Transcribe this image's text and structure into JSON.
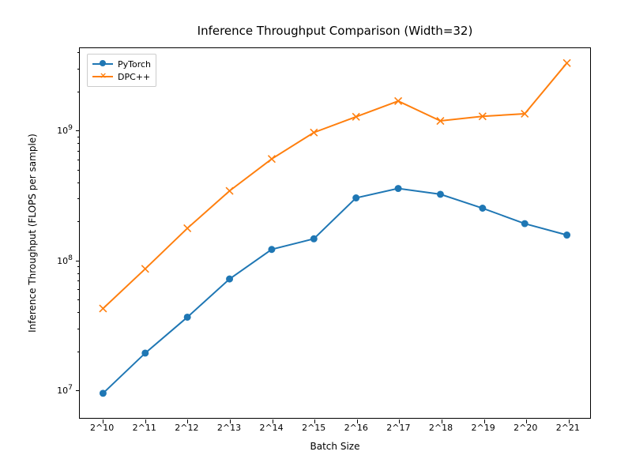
{
  "chart_data": {
    "type": "line",
    "title": "Inference Throughput Comparison (Width=32)",
    "xlabel": "Batch Size",
    "ylabel": "Inference Throughput (FLOPS per sample)",
    "yscale": "log",
    "ylim": [
      6000000.0,
      4300000000.0
    ],
    "categories": [
      "2^10",
      "2^11",
      "2^12",
      "2^13",
      "2^14",
      "2^15",
      "2^16",
      "2^17",
      "2^18",
      "2^19",
      "2^20",
      "2^21"
    ],
    "yticks": [
      {
        "value": 10000000.0,
        "label": "10^7"
      },
      {
        "value": 100000000.0,
        "label": "10^8"
      },
      {
        "value": 1000000000.0,
        "label": "10^9"
      }
    ],
    "series": [
      {
        "name": "PyTorch",
        "color": "#1f77b4",
        "marker": "o",
        "values": [
          9300000.0,
          19000000.0,
          36000000.0,
          71000000.0,
          120000000.0,
          145000000.0,
          300000000.0,
          355000000.0,
          320000000.0,
          250000000.0,
          190000000.0,
          155000000.0
        ]
      },
      {
        "name": "DPC++",
        "color": "#ff7f0e",
        "marker": "x",
        "values": [
          42000000.0,
          85000000.0,
          175000000.0,
          340000000.0,
          600000000.0,
          960000000.0,
          1270000000.0,
          1680000000.0,
          1180000000.0,
          1280000000.0,
          1340000000.0,
          3300000000.0
        ]
      }
    ],
    "legend_position": "upper left"
  }
}
